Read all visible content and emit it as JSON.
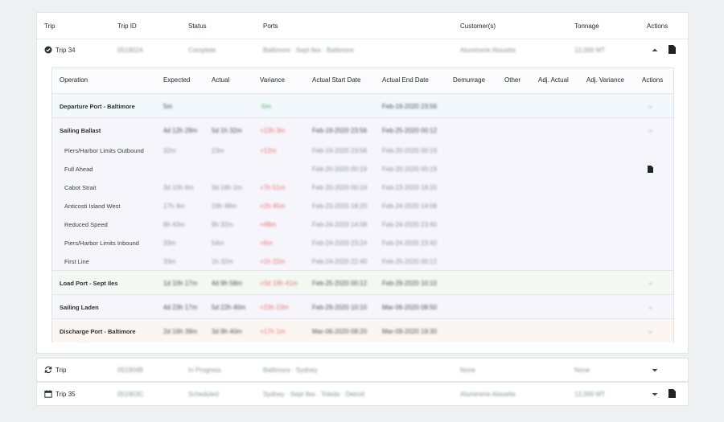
{
  "trips_table": {
    "headers": {
      "trip": "Trip",
      "trip_id": "Trip ID",
      "status": "Status",
      "ports": "Ports",
      "customers": "Customer(s)",
      "tonnage": "Tonnage",
      "actions": "Actions"
    },
    "expanded_trip": {
      "name": "Trip 34",
      "trip_id": "051902A",
      "status": "Complete",
      "ports": "Baltimore · Sept Iles · Baltimore",
      "customer": "Aluminerie Alouette",
      "tonnage": "12,000 MT"
    },
    "operations_table": {
      "headers": {
        "operation": "Operation",
        "expected": "Expected",
        "actual": "Actual",
        "variance": "Variance",
        "actual_start": "Actual Start Date",
        "actual_end": "Actual End Date",
        "demurrage": "Demurrage",
        "other": "Other",
        "adj_actual": "Adj. Actual",
        "adj_variance": "Adj. Variance",
        "actions": "Actions"
      },
      "departure": {
        "label": "Departure Port - Baltimore",
        "expected": "5m",
        "variance": "-5m",
        "end": "Feb-19-2020 23:56"
      },
      "sailing_ballast": {
        "label": "Sailing Ballast",
        "expected": "4d 12h 29m",
        "actual": "5d 1h 32m",
        "variance": "+13h 3m",
        "start": "Feb-19-2020 23:56",
        "end": "Feb-25-2020 00:12"
      },
      "legs": [
        {
          "label": "Piers/Harbor Limits Outbound",
          "expected": "32m",
          "actual": "23m",
          "variance": "+12m",
          "start": "Feb-19-2020 23:56",
          "end": "Feb-20-2020 00:19"
        },
        {
          "label": "Full Ahead",
          "expected": "",
          "actual": "",
          "variance": "",
          "start": "Feb-20-2020 00:19",
          "end": "Feb-20-2020 00:19"
        },
        {
          "label": "Cabot Strait",
          "expected": "3d 10h 6m",
          "actual": "3d 18h 1m",
          "variance": "+7h 51m",
          "start": "Feb-20-2020 00:19",
          "end": "Feb-23-2020 18:20"
        },
        {
          "label": "Anticosti Island West",
          "expected": "17h 4m",
          "actual": "19h 48m",
          "variance": "+2h 45m",
          "start": "Feb-23-2020 18:20",
          "end": "Feb-24-2020 14:08"
        },
        {
          "label": "Reduced Speed",
          "expected": "8h 43m",
          "actual": "9h 32m",
          "variance": "+48m",
          "start": "Feb-24-2020 14:08",
          "end": "Feb-24-2020 23:40"
        },
        {
          "label": "Piers/Harbor Limits Inbound",
          "expected": "33m",
          "actual": "54m",
          "variance": "+6m",
          "start": "Feb-24-2020 23:24",
          "end": "Feb-24-2020 23:40"
        },
        {
          "label": "First Line",
          "expected": "33m",
          "actual": "1h 32m",
          "variance": "+1h 22m",
          "start": "Feb-24-2020 22:40",
          "end": "Feb-25-2020 00:12"
        }
      ],
      "load_port": {
        "label": "Load Port - Sept Iles",
        "expected": "1d 10h 17m",
        "actual": "4d 9h 58m",
        "variance": "+3d 18h 41m",
        "start": "Feb-25-2020 00:12",
        "end": "Feb-29-2020 10:10"
      },
      "sailing_laden": {
        "label": "Sailing Laden",
        "expected": "4d 23h 17m",
        "actual": "5d 22h 40m",
        "variance": "+23h 23m",
        "start": "Feb-29-2020 10:10",
        "end": "Mar-06-2020 08:50"
      },
      "discharge": {
        "label": "Discharge Port - Baltimore",
        "expected": "2d 16h 39m",
        "actual": "3d 9h 40m",
        "variance": "+17h 1m",
        "start": "Mar-06-2020 08:20",
        "end": "Mar-09-2020 19:30"
      }
    },
    "other_trips": [
      {
        "name": "Trip",
        "trip_id": "051904B",
        "status": "In Progress",
        "ports": "Baltimore · Sydney",
        "customer": "None",
        "tonnage": "None"
      },
      {
        "name": "Trip 35",
        "trip_id": "051903C",
        "status": "Scheduled",
        "ports": "Sydney · Sept Iles · Toledo · Detroit",
        "customer": "Aluminerie Alouette",
        "tonnage": "12,000 MT"
      }
    ]
  }
}
